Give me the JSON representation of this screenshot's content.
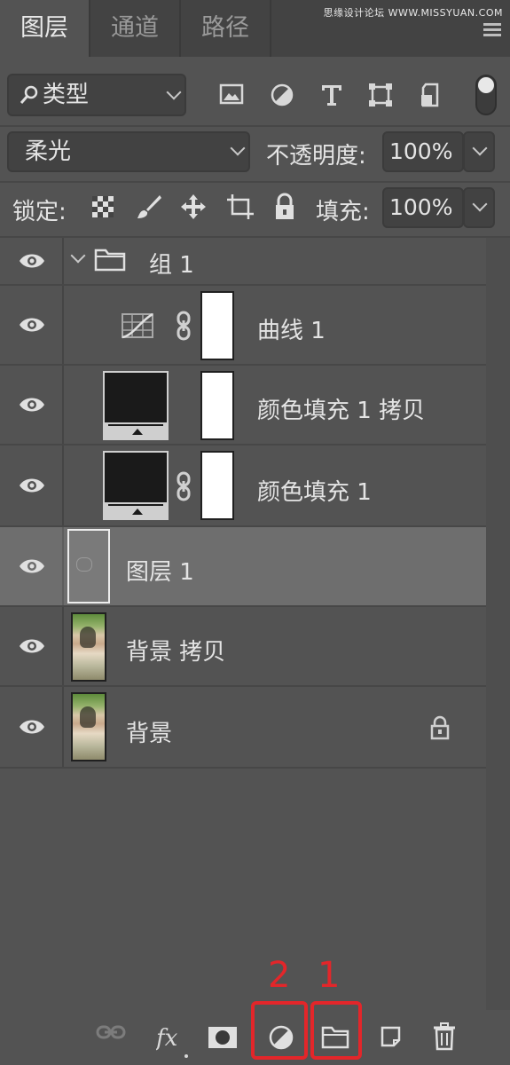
{
  "tabs": [
    "图层",
    "通道",
    "路径"
  ],
  "watermark": "思缘设计论坛 WWW.MISSYUAN.COM",
  "filter": {
    "label": "类型",
    "icons": [
      "image-filter-icon",
      "adjustment-filter-icon",
      "type-filter-icon",
      "shape-filter-icon",
      "smart-object-filter-icon",
      "filter-toggle"
    ]
  },
  "blend": {
    "mode": "柔光",
    "opacity_label": "不透明度:",
    "opacity_value": "100%"
  },
  "lock": {
    "label": "锁定:",
    "fill_label": "填充:",
    "fill_value": "100%"
  },
  "layers": [
    {
      "name": "组 1",
      "type": "group"
    },
    {
      "name": "曲线 1",
      "type": "curves"
    },
    {
      "name": "颜色填充 1 拷贝",
      "type": "fill"
    },
    {
      "name": "颜色填充 1",
      "type": "fill"
    },
    {
      "name": "图层 1",
      "type": "pixel",
      "selected": true
    },
    {
      "name": "背景 拷贝",
      "type": "photo"
    },
    {
      "name": "背景",
      "type": "photo",
      "locked": true
    }
  ],
  "annotations": {
    "n1": "1",
    "n2": "2"
  },
  "colors": {
    "panel": "#535353",
    "tabbar": "#434343",
    "selected": "#6e6e6e",
    "annotation": "#e3262a"
  }
}
